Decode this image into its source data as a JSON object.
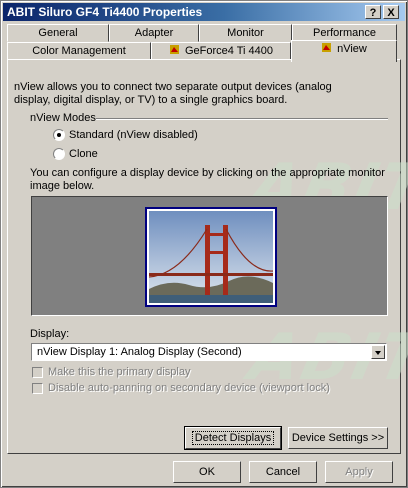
{
  "window": {
    "title": "ABIT Siluro GF4 Ti4400 Properties",
    "help_btn": "?",
    "close_btn": "X"
  },
  "tabs_back": [
    "General",
    "Adapter",
    "Monitor",
    "Performance"
  ],
  "tabs_front": [
    "Color Management",
    "GeForce4 Ti 4400",
    "nView"
  ],
  "active_tab": "nView",
  "intro_line1": "nView allows you to connect two separate output devices (analog",
  "intro_line2": "display, digital display, or TV) to a single graphics board.",
  "modes": {
    "group_label": "nView Modes",
    "standard_label": "Standard (nView disabled)",
    "clone_label": "Clone",
    "selected": "Standard"
  },
  "configure_line1": "You can configure a display device by clicking on the appropriate monitor",
  "configure_line2": "image below.",
  "display": {
    "label": "Display:",
    "selected": "nView Display 1: Analog Display  (Second)"
  },
  "checks": {
    "primary_label": "Make this the primary display",
    "autopan_label": "Disable auto-panning on secondary device (viewport lock)"
  },
  "buttons": {
    "detect": "Detect Displays",
    "device_settings": "Device Settings >>",
    "ok": "OK",
    "cancel": "Cancel",
    "apply": "Apply"
  },
  "watermark": {
    "line1": "ABIT",
    "line2": "ABIT"
  },
  "colors": {
    "titlebar_start": "#0a246a",
    "titlebar_end": "#a6caf0",
    "face": "#d4d0c8",
    "monitor_frame": "#000080"
  }
}
